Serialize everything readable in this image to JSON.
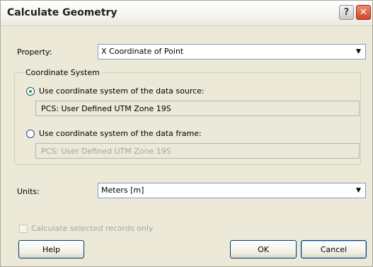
{
  "window": {
    "title": "Calculate Geometry"
  },
  "titlebar": {
    "help_glyph": "?",
    "close_glyph": "✕"
  },
  "property": {
    "label": "Property:",
    "value": "X Coordinate of Point"
  },
  "coordinate_system": {
    "group_label": "Coordinate System",
    "option_source": {
      "label": "Use coordinate system of the data source:",
      "selected": true,
      "value": "PCS: User Defined UTM Zone 19S"
    },
    "option_frame": {
      "label": "Use coordinate system of the data frame:",
      "selected": false,
      "value": "PCS: User Defined UTM Zone 19S"
    }
  },
  "units": {
    "label": "Units:",
    "value": "Meters [m]"
  },
  "selected_only": {
    "label": "Calculate selected records only",
    "checked": false,
    "enabled": false
  },
  "buttons": {
    "help": "Help",
    "ok": "OK",
    "cancel": "Cancel"
  },
  "icons": {
    "dropdown": "chevron-down-icon"
  }
}
